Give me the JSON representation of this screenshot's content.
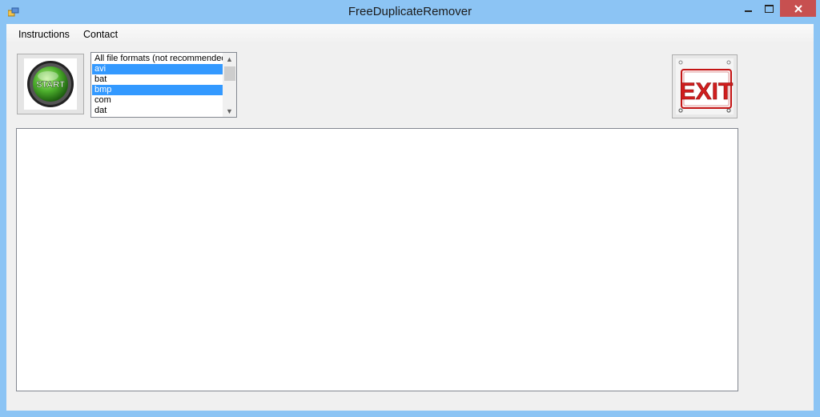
{
  "window": {
    "title": "FreeDuplicateRemover"
  },
  "menu": {
    "items": [
      {
        "label": "Instructions"
      },
      {
        "label": "Contact"
      }
    ]
  },
  "start_button": {
    "label": "START"
  },
  "exit_button": {
    "label": "EXIT"
  },
  "formats_list": {
    "items": [
      {
        "label": "All file formats (not recommended)",
        "selected": false
      },
      {
        "label": "avi",
        "selected": true
      },
      {
        "label": "bat",
        "selected": false
      },
      {
        "label": "bmp",
        "selected": true
      },
      {
        "label": "com",
        "selected": false
      },
      {
        "label": "dat",
        "selected": false
      }
    ]
  },
  "output": {
    "text": ""
  },
  "colors": {
    "selection": "#3399ff",
    "close_button": "#c75050",
    "titlebar": "#8cc4f4",
    "exit_red": "#d01e1e",
    "start_green": "#4caf2c"
  }
}
